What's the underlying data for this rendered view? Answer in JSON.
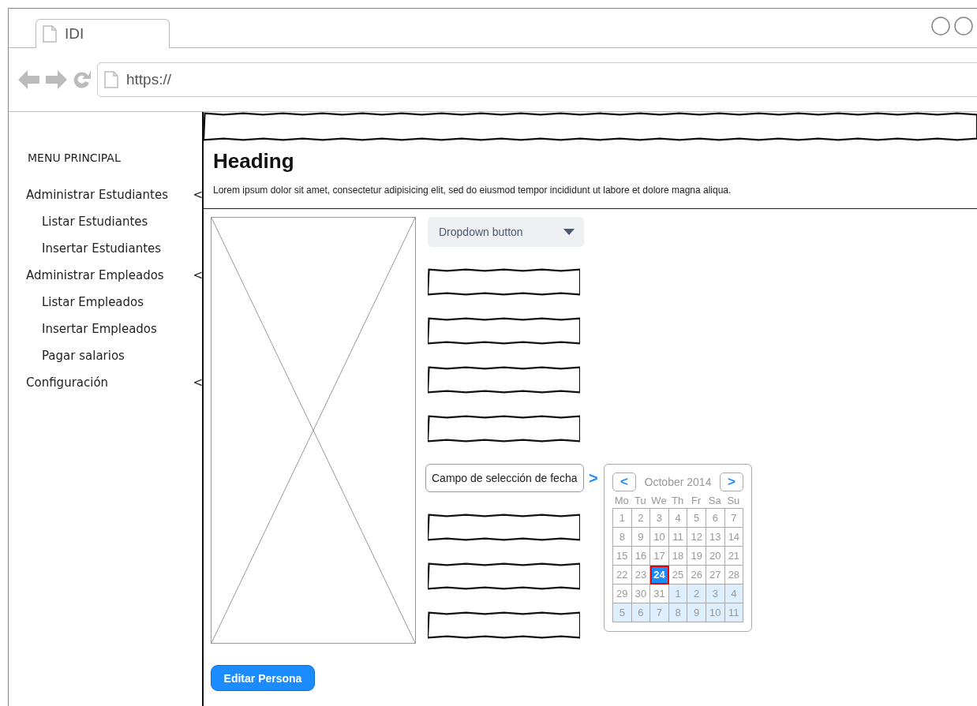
{
  "browser": {
    "tab_title": "IDI",
    "url": "https://"
  },
  "sidebar": {
    "title": "MENU PRINCIPAL",
    "items": [
      {
        "label": "Administrar Estudiantes",
        "caret": "<",
        "children": [
          {
            "label": "Listar Estudiantes"
          },
          {
            "label": "Insertar Estudiantes"
          }
        ]
      },
      {
        "label": "Administrar Empleados",
        "caret": "<",
        "children": [
          {
            "label": "Listar Empleados"
          },
          {
            "label": "Insertar Empleados"
          },
          {
            "label": "Pagar salarios"
          }
        ]
      },
      {
        "label": "Configuración",
        "caret": "<"
      }
    ]
  },
  "header": {
    "heading": "Heading",
    "text": "Lorem ipsum dolor sit amet, consectetur adipisicing elit, sed do eiusmod tempor incididunt ut labore et dolore magna aliqua."
  },
  "form": {
    "fields": [
      {
        "kind": "dropdown",
        "label": "Dropdown button"
      },
      {
        "kind": "sketch"
      },
      {
        "kind": "sketch"
      },
      {
        "kind": "sketch"
      },
      {
        "kind": "sketch"
      },
      {
        "kind": "date",
        "value": "Campo de selección de fecha",
        "toggle": ">"
      },
      {
        "kind": "sketch"
      },
      {
        "kind": "sketch"
      },
      {
        "kind": "sketch"
      }
    ]
  },
  "calendar": {
    "prev": "<",
    "next": ">",
    "month": "October 2014",
    "weekdays": [
      "Mo",
      "Tu",
      "We",
      "Th",
      "Fr",
      "Sa",
      "Su"
    ],
    "days": [
      {
        "label": "1",
        "other_month": false,
        "selected": false
      },
      {
        "label": "2",
        "other_month": false,
        "selected": false
      },
      {
        "label": "3",
        "other_month": false,
        "selected": false
      },
      {
        "label": "4",
        "other_month": false,
        "selected": false
      },
      {
        "label": "5",
        "other_month": false,
        "selected": false
      },
      {
        "label": "6",
        "other_month": false,
        "selected": false
      },
      {
        "label": "7",
        "other_month": false,
        "selected": false
      },
      {
        "label": "8",
        "other_month": false,
        "selected": false
      },
      {
        "label": "9",
        "other_month": false,
        "selected": false
      },
      {
        "label": "10",
        "other_month": false,
        "selected": false
      },
      {
        "label": "11",
        "other_month": false,
        "selected": false
      },
      {
        "label": "12",
        "other_month": false,
        "selected": false
      },
      {
        "label": "13",
        "other_month": false,
        "selected": false
      },
      {
        "label": "14",
        "other_month": false,
        "selected": false
      },
      {
        "label": "15",
        "other_month": false,
        "selected": false
      },
      {
        "label": "16",
        "other_month": false,
        "selected": false
      },
      {
        "label": "17",
        "other_month": false,
        "selected": false
      },
      {
        "label": "18",
        "other_month": false,
        "selected": false
      },
      {
        "label": "19",
        "other_month": false,
        "selected": false
      },
      {
        "label": "20",
        "other_month": false,
        "selected": false
      },
      {
        "label": "21",
        "other_month": false,
        "selected": false
      },
      {
        "label": "22",
        "other_month": false,
        "selected": false
      },
      {
        "label": "23",
        "other_month": false,
        "selected": false
      },
      {
        "label": "24",
        "other_month": false,
        "selected": true
      },
      {
        "label": "25",
        "other_month": false,
        "selected": false
      },
      {
        "label": "26",
        "other_month": false,
        "selected": false
      },
      {
        "label": "27",
        "other_month": false,
        "selected": false
      },
      {
        "label": "28",
        "other_month": false,
        "selected": false
      },
      {
        "label": "29",
        "other_month": false,
        "selected": false
      },
      {
        "label": "30",
        "other_month": false,
        "selected": false
      },
      {
        "label": "31",
        "other_month": false,
        "selected": false
      },
      {
        "label": "1",
        "other_month": true,
        "selected": false
      },
      {
        "label": "2",
        "other_month": true,
        "selected": false
      },
      {
        "label": "3",
        "other_month": true,
        "selected": false
      },
      {
        "label": "4",
        "other_month": true,
        "selected": false
      },
      {
        "label": "5",
        "other_month": true,
        "selected": false
      },
      {
        "label": "6",
        "other_month": true,
        "selected": false
      },
      {
        "label": "7",
        "other_month": true,
        "selected": false
      },
      {
        "label": "8",
        "other_month": true,
        "selected": false
      },
      {
        "label": "9",
        "other_month": true,
        "selected": false
      },
      {
        "label": "10",
        "other_month": true,
        "selected": false
      },
      {
        "label": "11",
        "other_month": true,
        "selected": false
      }
    ]
  },
  "action_button": "Editar Persona"
}
